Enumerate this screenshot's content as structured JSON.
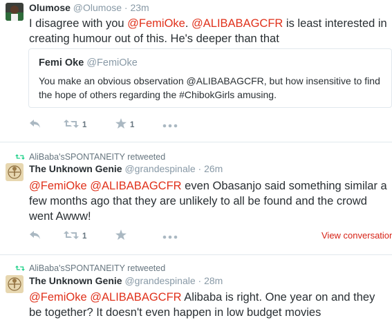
{
  "accent_color": "#e0311b",
  "tweets": [
    {
      "author_name": "Olumose",
      "author_handle": "@Olumose",
      "separator": "·",
      "time": "23m",
      "mention1": "@FemiOke",
      "mention2": "@ALIBABAGCFR",
      "text_a": "I disagree with you ",
      "text_b": ". ",
      "text_c": " is least interested in creating humour out of this. He's deeper than that",
      "quote": {
        "author_name": "Femi Oke",
        "author_handle": "@FemiOke",
        "text": "You make an obvious observation @ALIBABAGCFR, but how insensitive to find the hope of others regarding the #ChibokGirls amusing."
      },
      "actions": {
        "reply_icon": "reply-icon",
        "retweet_count": "1",
        "favorite_count": "1",
        "more_icon": "more-icon"
      }
    },
    {
      "retweet_context": "AliBaba'sSPONTANEITY retweeted",
      "author_name": "The Unknown Genie",
      "author_handle": "@grandespinale",
      "separator": "·",
      "time": "26m",
      "mention1": "@FemiOke",
      "mention2": "@ALIBABAGCFR",
      "text_rest": " even Obasanjo said something similar a few months ago that they are unlikely to all be found and the crowd went Awww!",
      "actions": {
        "retweet_count": "1",
        "view_conversation": "View conversation"
      }
    },
    {
      "retweet_context": "AliBaba'sSPONTANEITY retweeted",
      "author_name": "The Unknown Genie",
      "author_handle": "@grandespinale",
      "separator": "·",
      "time": "28m",
      "mention1": "@FemiOke",
      "mention2": "@ALIBABAGCFR",
      "text_rest": " Alibaba is right. One year on and they be together? It doesn't even happen in low budget movies"
    }
  ]
}
